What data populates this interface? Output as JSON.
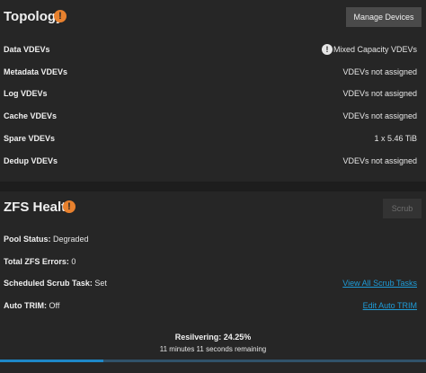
{
  "topology": {
    "title": "Topology",
    "warn_glyph": "!",
    "manage_button": "Manage Devices",
    "info_glyph": "!",
    "rows": [
      {
        "label": "Data VDEVs",
        "value": "Mixed Capacity VDEVs"
      },
      {
        "label": "Metadata VDEVs",
        "value": "VDEVs not assigned"
      },
      {
        "label": "Log VDEVs",
        "value": "VDEVs not assigned"
      },
      {
        "label": "Cache VDEVs",
        "value": "VDEVs not assigned"
      },
      {
        "label": "Spare VDEVs",
        "value": "1 x 5.46 TiB"
      },
      {
        "label": "Dedup VDEVs",
        "value": "VDEVs not assigned"
      }
    ]
  },
  "health": {
    "title": "ZFS Health",
    "warn_glyph": "!",
    "scrub_button": "Scrub",
    "pool_status_label": "Pool Status:",
    "pool_status_value": "Degraded",
    "errors_label": "Total ZFS Errors:",
    "errors_value": "0",
    "scrub_task_label": "Scheduled Scrub Task:",
    "scrub_task_value": "Set",
    "scrub_link": "View All Scrub Tasks",
    "trim_label": "Auto TRIM:",
    "trim_value": "Off",
    "trim_link": "Edit Auto TRIM",
    "resilver_label": "Resilvering: 24.25%",
    "resilver_remaining": "11 minutes 11 seconds remaining",
    "resilver_percent": 24.25
  },
  "colors": {
    "warning": "#e8812e",
    "link": "#1e9bd7",
    "progress": "#1e88c8"
  }
}
